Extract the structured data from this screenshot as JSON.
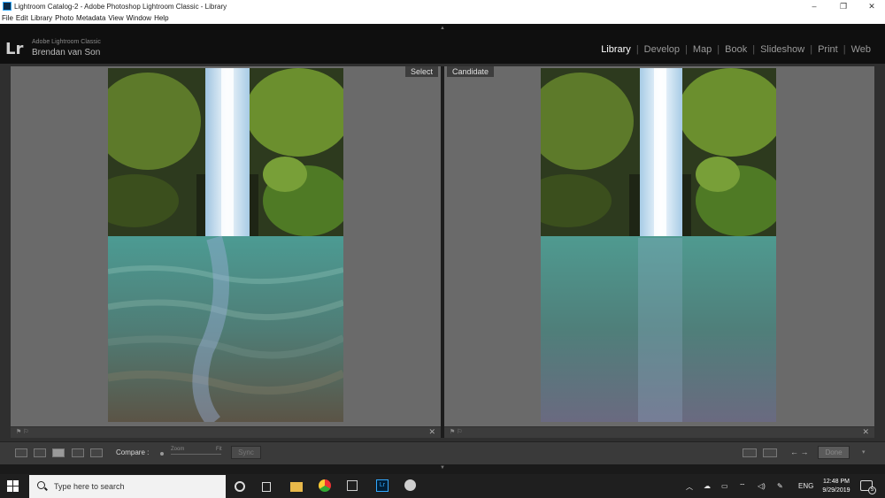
{
  "window": {
    "title": "Lightroom Catalog-2 - Adobe Photoshop Lightroom Classic - Library",
    "minimize": "–",
    "maximize": "❐",
    "close": "✕"
  },
  "menu": [
    "File",
    "Edit",
    "Library",
    "Photo",
    "Metadata",
    "View",
    "Window",
    "Help"
  ],
  "identity": {
    "logo": "Lr",
    "product": "Adobe Lightroom Classic",
    "user": "Brendan van Son"
  },
  "modules": [
    {
      "label": "Library",
      "active": true
    },
    {
      "label": "Develop",
      "active": false
    },
    {
      "label": "Map",
      "active": false
    },
    {
      "label": "Book",
      "active": false
    },
    {
      "label": "Slideshow",
      "active": false
    },
    {
      "label": "Print",
      "active": false
    },
    {
      "label": "Web",
      "active": false
    }
  ],
  "compare": {
    "select_label": "Select",
    "candidate_label": "Candidate"
  },
  "toolbar": {
    "compare_label": "Compare :",
    "zoom_label": "Zoom",
    "fit_label": "Fit",
    "sync_label": "Sync",
    "nav_arrows": "← →",
    "done_label": "Done"
  },
  "taskbar": {
    "search_placeholder": "Type here to search",
    "language": "ENG",
    "time": "12:48 PM",
    "date": "9/29/2019",
    "notification_count": "5"
  },
  "colors": {
    "lr_bg": "#0f0f0f",
    "pane_gray": "#6a6a6a",
    "taskbar": "#1f1f1f",
    "active_module": "#ffffff"
  }
}
